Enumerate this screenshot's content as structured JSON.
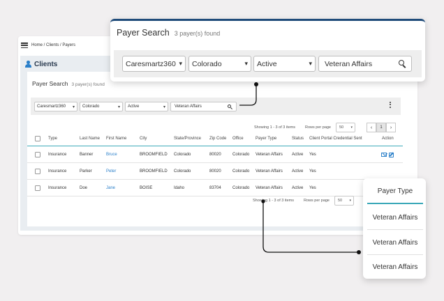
{
  "breadcrumb": "Home / Clients / Payers",
  "section_title": "Clients",
  "card": {
    "title": "Payer Search",
    "count": "3 payer(s) found"
  },
  "filters": {
    "agency": "Caresmartz360",
    "state": "Colorado",
    "status": "Active",
    "search_value": "Veteran Affairs"
  },
  "pagination": {
    "showing": "Showing 1 - 3 of 3 items",
    "rows_per_page_label": "Rows per page",
    "rows_per_page": "50",
    "prev": "‹",
    "page": "1",
    "next": "›"
  },
  "table": {
    "columns": [
      "Type",
      "Last Name",
      "First Name",
      "City",
      "State/Province",
      "Zip Code",
      "Office",
      "Payer Type",
      "Status",
      "Client Portal Credential Sent",
      "Action"
    ],
    "rows": [
      {
        "type": "Insurance",
        "last": "Banner",
        "first": "Bruce",
        "city": "BROOMFIELD",
        "state": "Colorado",
        "zip": "80020",
        "office": "Colorado",
        "payer_type": "Veteran Affairs",
        "status": "Active",
        "sent": "Yes"
      },
      {
        "type": "Insurance",
        "last": "Parker",
        "first": "Peter",
        "city": "BROOMFIELD",
        "state": "Colorado",
        "zip": "80020",
        "office": "Colorado",
        "payer_type": "Veteran Affairs",
        "status": "Active",
        "sent": "Yes"
      },
      {
        "type": "Insurance",
        "last": "Doe",
        "first": "Jane",
        "city": "BOISE",
        "state": "Idaho",
        "zip": "83704",
        "office": "Colorado",
        "payer_type": "Veteran Affairs",
        "status": "Active",
        "sent": "Yes"
      }
    ]
  },
  "zoom_payer": {
    "header": "Payer Type",
    "values": [
      "Veteran Affairs",
      "Veteran Affairs",
      "Veteran Affairs"
    ]
  },
  "colors": {
    "accent": "#2a7fc9",
    "teal": "#3aa8b8",
    "navy": "#1f4b7a",
    "background": "#f1eff0"
  },
  "icons": [
    "menu-icon",
    "person-icon",
    "chevron-down-icon",
    "search-icon",
    "kebab-menu-icon",
    "mail-icon",
    "edit-icon"
  ]
}
